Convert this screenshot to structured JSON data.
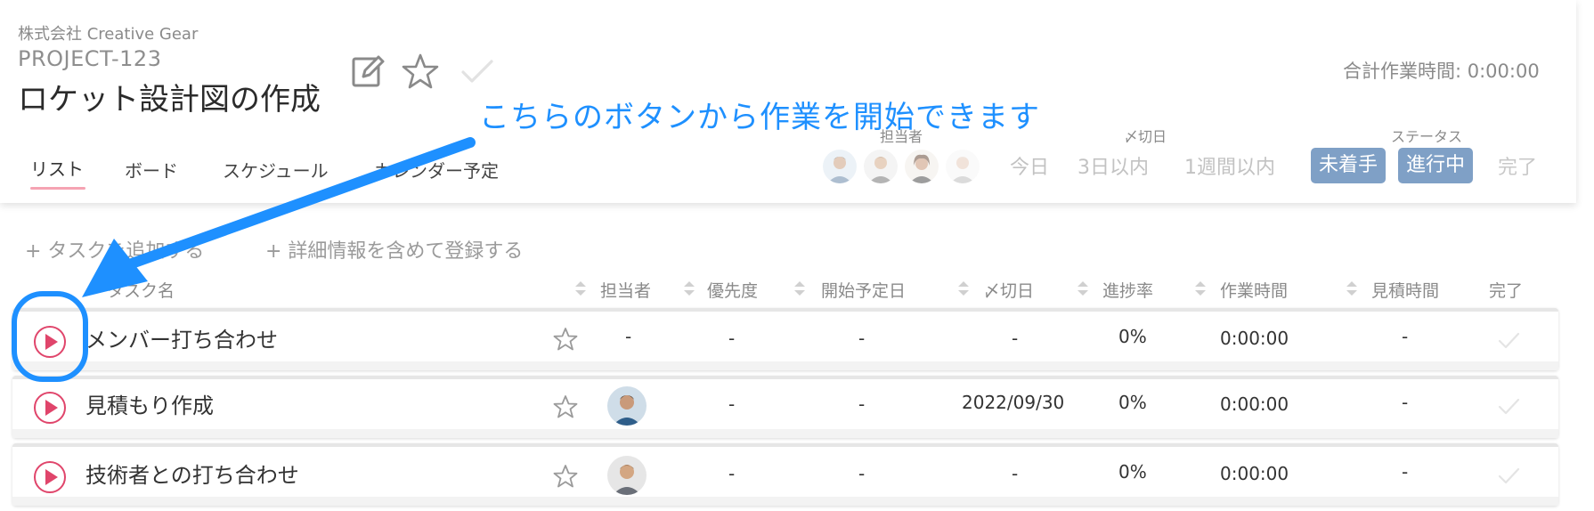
{
  "header": {
    "company": "株式会社 Creative Gear",
    "project_code": "PROJECT-123",
    "project_title": "ロケット設計図の作成",
    "total_time": "合計作業時間: 0:00:00",
    "icons": [
      "edit-icon",
      "star-icon",
      "check-icon"
    ]
  },
  "tabs": [
    {
      "label": "リスト",
      "active": true
    },
    {
      "label": "ボード"
    },
    {
      "label": "スケジュール"
    },
    {
      "label": "カレンダー予定"
    }
  ],
  "filters": {
    "assignee_label": "担当者",
    "deadline_label": "〆切日",
    "status_label": "ステータス",
    "deadline_options": [
      "今日",
      "3日以内",
      "1週間以内"
    ],
    "status_options": [
      "未着手",
      "進行中",
      "完了"
    ]
  },
  "actions": {
    "add_task": "+ タスクを追加する",
    "add_detailed": "+ 詳細情報を含めて登録する"
  },
  "columns": {
    "task_name": "タスク名",
    "assignee": "担当者",
    "priority": "優先度",
    "start_date": "開始予定日",
    "deadline": "〆切日",
    "progress": "進捗率",
    "work_time": "作業時間",
    "estimate": "見積時間",
    "done": "完了"
  },
  "tasks": [
    {
      "name": "メンバー打ち合わせ",
      "assignee": "-",
      "priority": "-",
      "start": "-",
      "deadline": "-",
      "progress": "0%",
      "work_time": "0:00:00",
      "estimate": "-"
    },
    {
      "name": "見積もり作成",
      "assignee": "",
      "priority": "-",
      "start": "-",
      "deadline": "2022/09/30",
      "progress": "0%",
      "work_time": "0:00:00",
      "estimate": "-"
    },
    {
      "name": "技術者との打ち合わせ",
      "assignee": "",
      "priority": "-",
      "start": "-",
      "deadline": "-",
      "progress": "0%",
      "work_time": "0:00:00",
      "estimate": "-"
    }
  ],
  "annotation": {
    "text": "こちらのボタンから作業を開始できます"
  },
  "colors": {
    "accent_blue": "#1e90ff",
    "play_pink": "#e0456b",
    "status_bg": "#7fa0c6"
  }
}
